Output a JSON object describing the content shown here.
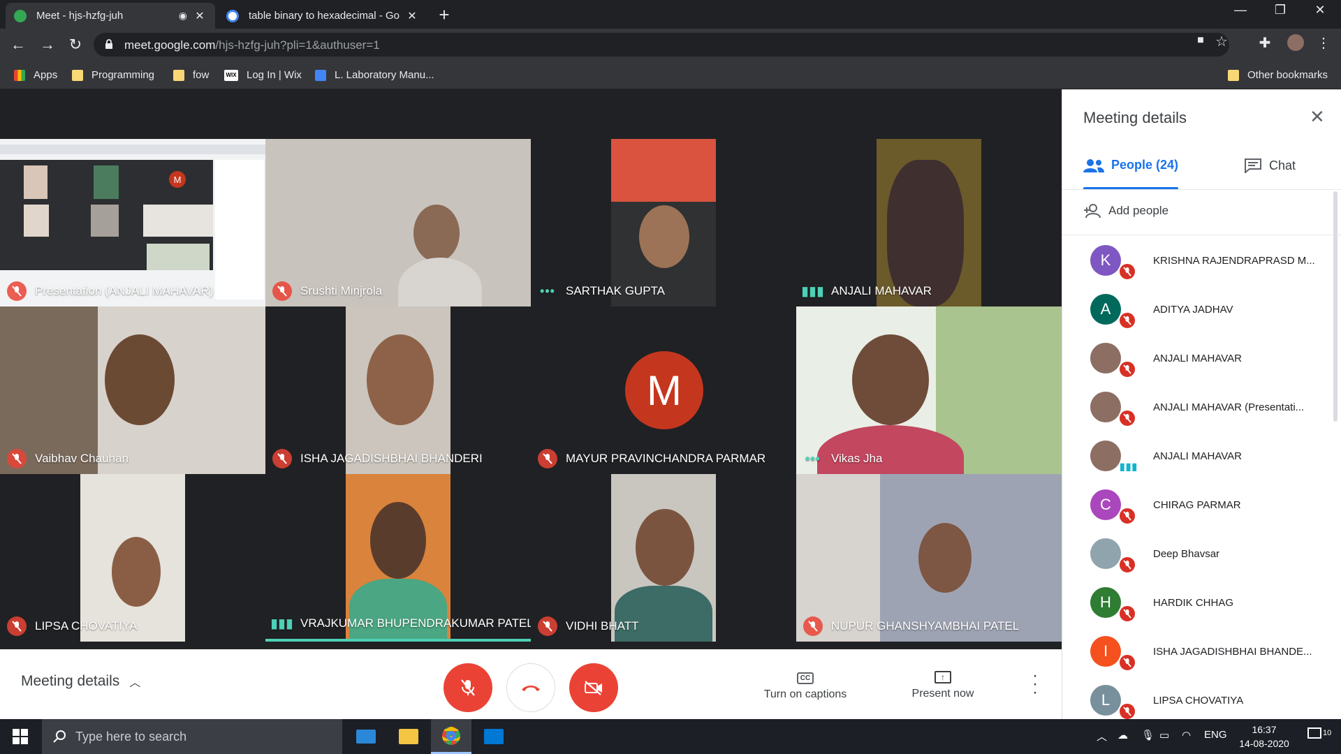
{
  "browser": {
    "tabs": [
      {
        "title": "Meet - hjs-hzfg-juh",
        "active": true
      },
      {
        "title": "table binary to hexadecimal - Go",
        "active": false
      }
    ],
    "url_host": "meet.google.com",
    "url_path": "/hjs-hzfg-juh?pli=1&authuser=1",
    "bookmarks": [
      {
        "label": "Apps"
      },
      {
        "label": "Programming"
      },
      {
        "label": "fow"
      },
      {
        "label": "Log In | Wix"
      },
      {
        "label": "L. Laboratory Manu..."
      }
    ],
    "other_bookmarks": "Other bookmarks"
  },
  "meet": {
    "tiles": [
      {
        "name": "Presentation (ANJALI MAHAVAR)",
        "status": "muted"
      },
      {
        "name": "Srushti Minjrola",
        "status": "muted"
      },
      {
        "name": "SARTHAK GUPTA",
        "status": "dots"
      },
      {
        "name": "ANJALI MAHAVAR",
        "status": "speaking"
      },
      {
        "name": "Vaibhav Chauhan",
        "status": "muted"
      },
      {
        "name": "ISHA JAGADISHBHAI BHANDERI",
        "status": "muted"
      },
      {
        "name": "MAYUR PRAVINCHANDRA PARMAR",
        "status": "muted",
        "avatar": "M"
      },
      {
        "name": "Vikas Jha",
        "status": "dots"
      },
      {
        "name": "LIPSA CHOVATIYA",
        "status": "muted"
      },
      {
        "name": "VRAJKUMAR BHUPENDRAKUMAR PATEL",
        "status": "speaking"
      },
      {
        "name": "VIDHI BHATT",
        "status": "muted"
      },
      {
        "name": "NUPUR GHANSHYAMBHAI PATEL",
        "status": "muted"
      }
    ],
    "presentation_thumb_avatar": "M",
    "bottom_bar": {
      "meeting_details": "Meeting details",
      "captions": "Turn on captions",
      "present": "Present now"
    }
  },
  "panel": {
    "title": "Meeting details",
    "tab_people": "People (24)",
    "tab_chat": "Chat",
    "add_people": "Add people",
    "people": [
      {
        "name": "KRISHNA RAJENDRAPRASD M...",
        "initial": "K",
        "color": "#7e57c2",
        "state": "muted"
      },
      {
        "name": "ADITYA JADHAV",
        "initial": "A",
        "color": "#00695c",
        "state": "muted"
      },
      {
        "name": "ANJALI MAHAVAR",
        "initial": "",
        "color": "#8d6e63",
        "state": "muted"
      },
      {
        "name": "ANJALI MAHAVAR (Presentati...",
        "initial": "",
        "color": "#8d6e63",
        "state": "muted"
      },
      {
        "name": "ANJALI MAHAVAR",
        "initial": "",
        "color": "#8d6e63",
        "state": "speaking"
      },
      {
        "name": "CHIRAG PARMAR",
        "initial": "C",
        "color": "#ab47bc",
        "state": "muted"
      },
      {
        "name": "Deep Bhavsar",
        "initial": "",
        "color": "#90a4ae",
        "state": "muted"
      },
      {
        "name": "HARDIK CHHAG",
        "initial": "H",
        "color": "#2e7d32",
        "state": "muted"
      },
      {
        "name": "ISHA JAGADISHBHAI BHANDE...",
        "initial": "I",
        "color": "#f4511e",
        "state": "muted"
      },
      {
        "name": "LIPSA CHOVATIYA",
        "initial": "L",
        "color": "#78909c",
        "state": "muted"
      }
    ]
  },
  "taskbar": {
    "search_placeholder": "Type here to search",
    "language": "ENG",
    "time": "16:37",
    "date": "14-08-2020",
    "notification_count": "10"
  },
  "colors": {
    "meet_red": "#ea4335",
    "accent_blue": "#1a73e8",
    "speaking_teal": "#4dd0b5"
  }
}
